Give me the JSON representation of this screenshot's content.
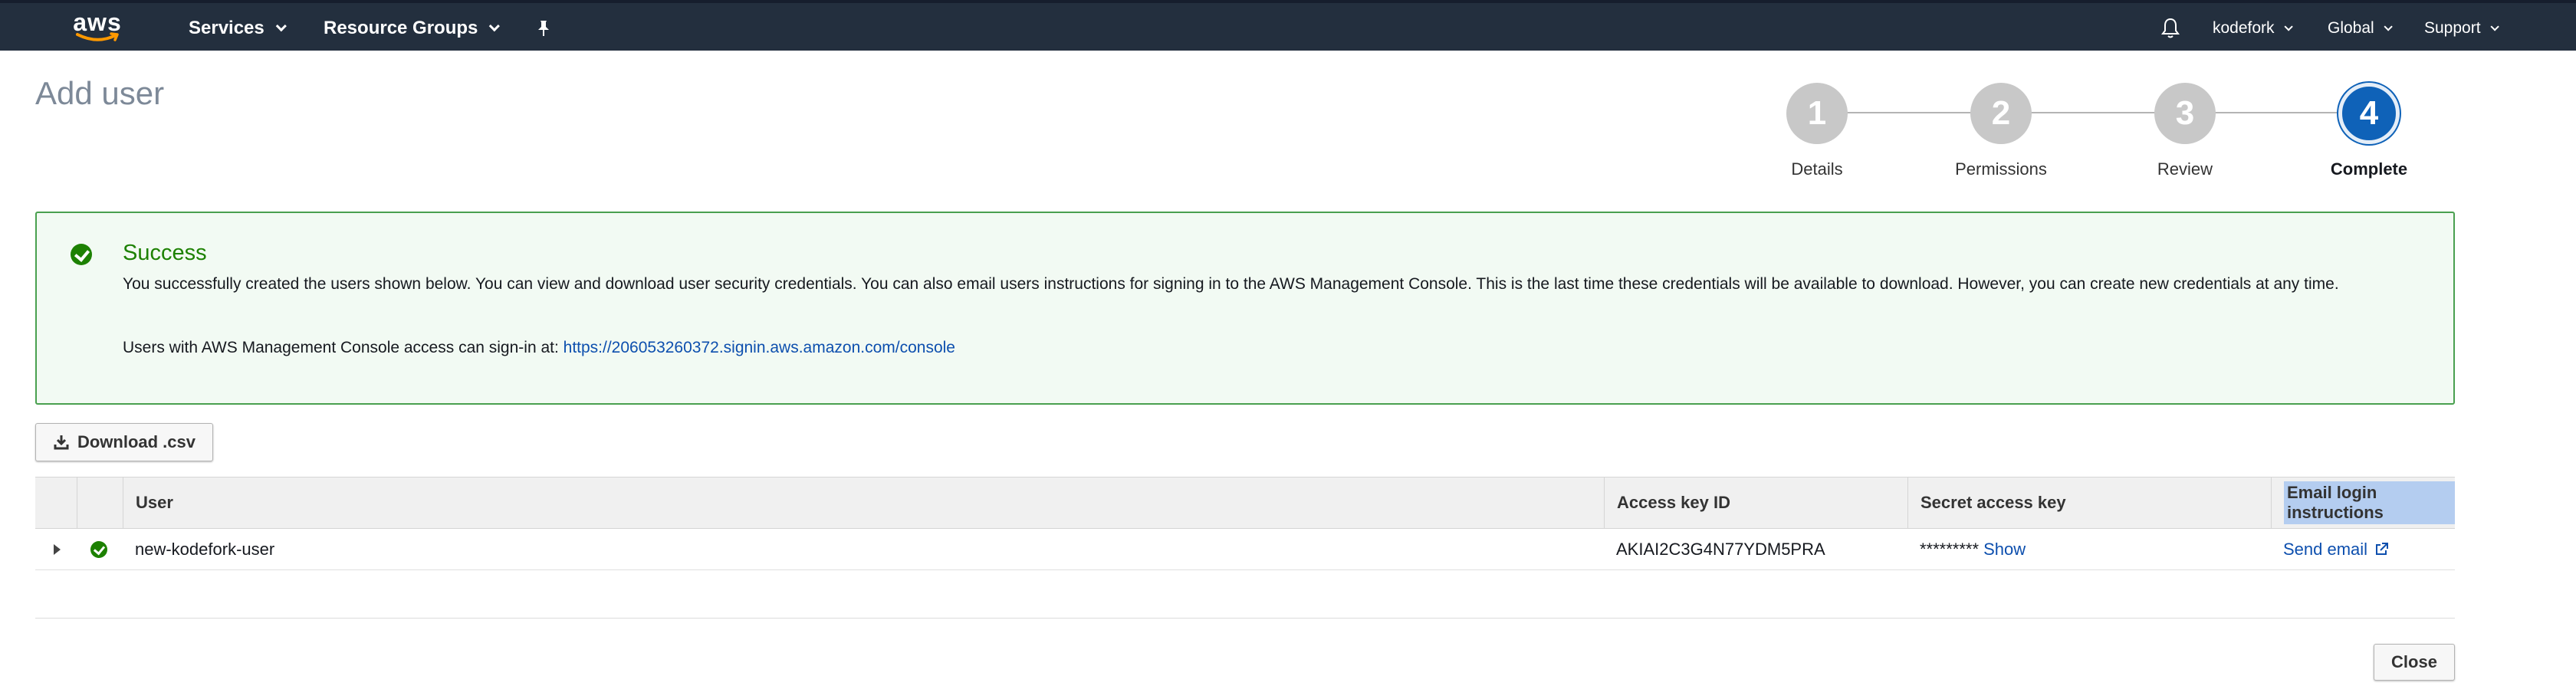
{
  "nav": {
    "logo_text": "aws",
    "services": "Services",
    "resource_groups": "Resource Groups",
    "pin_icon": "pin-icon",
    "bell_icon": "bell-icon",
    "account": "kodefork",
    "region": "Global",
    "support": "Support"
  },
  "page": {
    "title": "Add user"
  },
  "steps": [
    {
      "number": "1",
      "label": "Details",
      "active": false
    },
    {
      "number": "2",
      "label": "Permissions",
      "active": false
    },
    {
      "number": "3",
      "label": "Review",
      "active": false
    },
    {
      "number": "4",
      "label": "Complete",
      "active": true
    }
  ],
  "success": {
    "title": "Success",
    "message": "You successfully created the users shown below. You can view and download user security credentials. You can also email users instructions for signing in to the AWS Management Console. This is the last time these credentials will be available to download. However, you can create new credentials at any time.",
    "signin_prefix": "Users with AWS Management Console access can sign-in at: ",
    "signin_url": "https://206053260372.signin.aws.amazon.com/console",
    "color": "#1d8102"
  },
  "actions": {
    "download_csv": "Download .csv",
    "close": "Close"
  },
  "table": {
    "headers": {
      "user": "User",
      "access_key_id": "Access key ID",
      "secret_access_key": "Secret access key",
      "email_login": "Email login instructions"
    },
    "rows": [
      {
        "user": "new-kodefork-user",
        "access_key_id": "AKIAI2C3G4N77YDM5PRA",
        "secret_masked": "*********",
        "show_label": "Show",
        "email_label": "Send email"
      }
    ]
  },
  "colors": {
    "nav_bg": "#232f3e",
    "accent_blue": "#0f62b8",
    "link": "#0d4fae"
  }
}
